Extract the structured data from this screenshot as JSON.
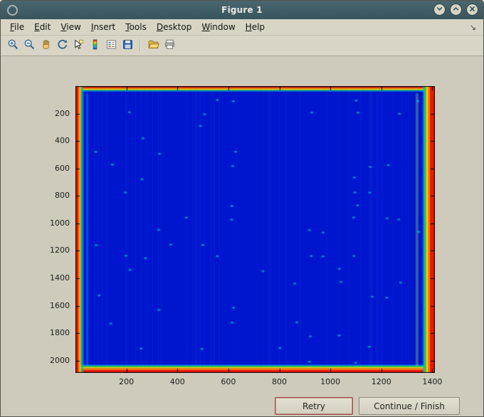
{
  "window": {
    "title": "Figure 1",
    "controls": [
      "minimize",
      "maximize",
      "close"
    ]
  },
  "menu": {
    "items": [
      "File",
      "Edit",
      "View",
      "Insert",
      "Tools",
      "Desktop",
      "Window",
      "Help"
    ],
    "overflow_glyph": "↘"
  },
  "toolbar": {
    "items": [
      "zoom-in",
      "zoom-out",
      "pan",
      "rotate-3d",
      "data-cursor",
      "colorbar",
      "legend",
      "save",
      "separator",
      "open-folder",
      "print"
    ]
  },
  "plot": {
    "x_ticks": [
      200,
      400,
      600,
      800,
      1000,
      1200,
      1400
    ],
    "y_ticks": [
      200,
      400,
      600,
      800,
      1000,
      1200,
      1400,
      1600,
      1800,
      2000
    ],
    "x_range": [
      0,
      1410
    ],
    "y_range": [
      0,
      2090
    ],
    "image": {
      "background": "#0016ce",
      "grid_rows": 21,
      "grid_cols": 22,
      "dot_core": "#8f0000",
      "dot_mid": "#ef2a00",
      "dot_outer": "#ff9500",
      "dot_ring": "#ffe73e",
      "dot_rim": "#2fbf4e",
      "edge_colors": [
        "#e71800",
        "#ff7b00",
        "#ffd400",
        "#35c34e",
        "#00b4ff"
      ]
    }
  },
  "footer": {
    "retry": "Retry",
    "continue": "Continue / Finish"
  }
}
